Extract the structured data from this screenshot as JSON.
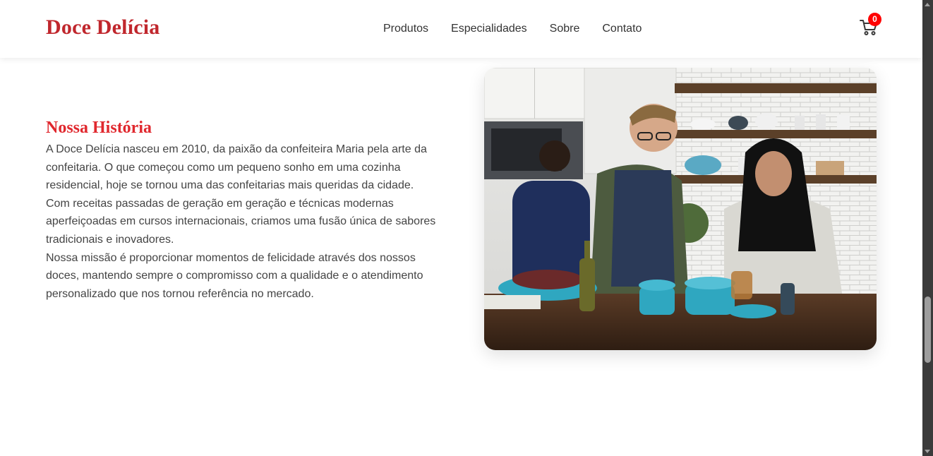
{
  "brand": {
    "name": "Doce Delícia",
    "color": "#c0272d"
  },
  "nav": {
    "items": [
      {
        "label": "Produtos"
      },
      {
        "label": "Especialidades"
      },
      {
        "label": "Sobre"
      },
      {
        "label": "Contato"
      }
    ]
  },
  "cart": {
    "icon": "shopping-cart-icon",
    "count": "0",
    "badge_color": "#ff0000"
  },
  "about": {
    "heading": "Nossa História",
    "heading_color": "#e0282e",
    "paragraphs": [
      "A Doce Delícia nasceu em 2010, da paixão da confeiteira Maria pela arte da confeitaria. O que começou como um pequeno sonho em uma cozinha residencial, hoje se tornou uma das confeitarias mais queridas da cidade.",
      "Com receitas passadas de geração em geração e técnicas modernas aperfeiçoadas em cursos internacionais, criamos uma fusão única de sabores tradicionais e inovadores.",
      "Nossa missão é proporcionar momentos de felicidade através dos nossos doces, mantendo sempre o compromisso com a qualidade e o atendimento personalizado que nos tornou referência no mercado."
    ],
    "image": "kitchen-team-photo"
  }
}
